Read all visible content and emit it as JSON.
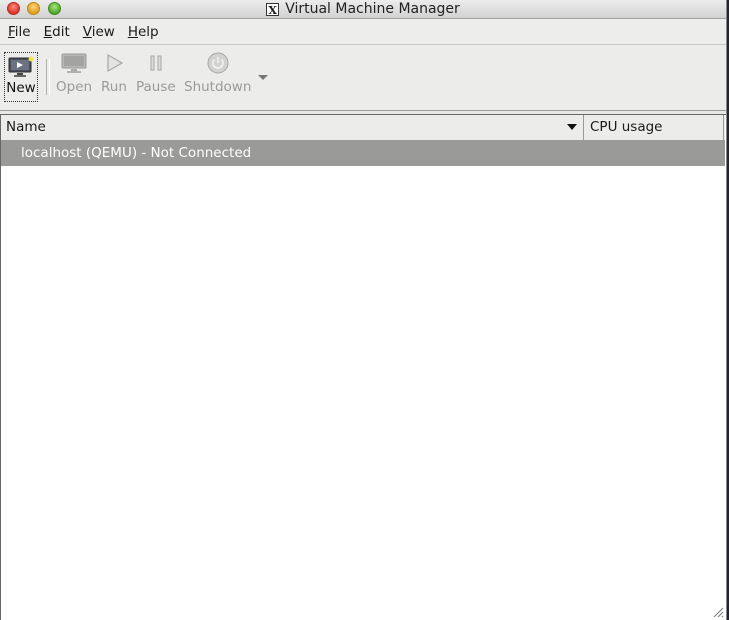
{
  "window": {
    "title": "Virtual Machine Manager"
  },
  "menu": {
    "items": [
      {
        "mnemonic": "F",
        "rest": "ile"
      },
      {
        "mnemonic": "E",
        "rest": "dit"
      },
      {
        "mnemonic": "V",
        "rest": "iew"
      },
      {
        "mnemonic": "H",
        "rest": "elp"
      }
    ]
  },
  "toolbar": {
    "new_label": "New",
    "open_label": "Open",
    "run_label": "Run",
    "pause_label": "Pause",
    "shutdown_label": "Shutdown"
  },
  "table": {
    "columns": [
      "Name",
      "CPU usage"
    ],
    "rows": [
      {
        "name": "localhost (QEMU) - Not Connected",
        "cpu": ""
      }
    ]
  },
  "colors": {
    "selected_row": "#9a9a98",
    "toolbar_bg": "#ececea"
  }
}
